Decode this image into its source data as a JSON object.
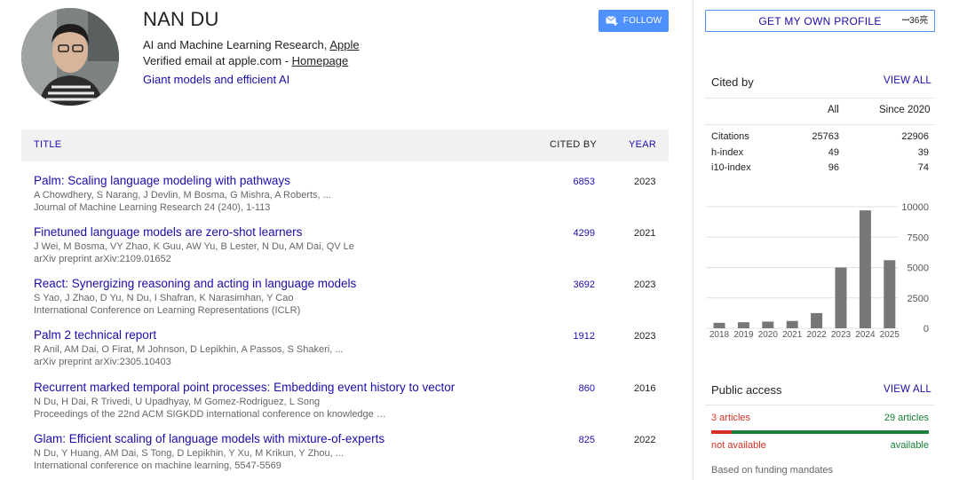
{
  "profile": {
    "name": "NAN DU",
    "affiliation_prefix": "AI and Machine Learning Research, ",
    "affiliation_link": "Apple",
    "verified_prefix": "Verified email at apple.com - ",
    "homepage_link": "Homepage",
    "interest": "Giant models and efficient AI",
    "follow_label": "FOLLOW"
  },
  "table": {
    "header": {
      "title": "TITLE",
      "cited_by": "CITED BY",
      "year": "YEAR"
    },
    "rows": [
      {
        "title": "Palm: Scaling language modeling with pathways",
        "authors": "A Chowdhery, S Narang, J Devlin, M Bosma, G Mishra, A Roberts, ...",
        "venue": "Journal of Machine Learning Research 24 (240), 1-113",
        "cited_by": "6853",
        "year": "2023"
      },
      {
        "title": "Finetuned language models are zero-shot learners",
        "authors": "J Wei, M Bosma, VY Zhao, K Guu, AW Yu, B Lester, N Du, AM Dai, QV Le",
        "venue": "arXiv preprint arXiv:2109.01652",
        "cited_by": "4299",
        "year": "2021"
      },
      {
        "title": "React: Synergizing reasoning and acting in language models",
        "authors": "S Yao, J Zhao, D Yu, N Du, I Shafran, K Narasimhan, Y Cao",
        "venue": "International Conference on Learning Representations (ICLR)",
        "cited_by": "3692",
        "year": "2023"
      },
      {
        "title": "Palm 2 technical report",
        "authors": "R Anil, AM Dai, O Firat, M Johnson, D Lepikhin, A Passos, S Shakeri, ...",
        "venue": "arXiv preprint arXiv:2305.10403",
        "cited_by": "1912",
        "year": "2023"
      },
      {
        "title": "Recurrent marked temporal point processes: Embedding event history to vector",
        "authors": "N Du, H Dai, R Trivedi, U Upadhyay, M Gomez-Rodriguez, L Song",
        "venue": "Proceedings of the 22nd ACM SIGKDD international conference on knowledge …",
        "cited_by": "860",
        "year": "2016"
      },
      {
        "title": "Glam: Efficient scaling of language models with mixture-of-experts",
        "authors": "N Du, Y Huang, AM Dai, S Tong, D Lepikhin, Y Xu, M Krikun, Y Zhou, ...",
        "venue": "International conference on machine learning, 5547-5569",
        "cited_by": "825",
        "year": "2022"
      }
    ]
  },
  "sidebar": {
    "own_profile_label": "GET MY OWN PROFILE",
    "badge": "ꟷ36亮",
    "cited_by": {
      "title": "Cited by",
      "view_all": "VIEW ALL",
      "col_all": "All",
      "col_since": "Since 2020",
      "stats": [
        {
          "label": "Citations",
          "all": "25763",
          "since": "22906"
        },
        {
          "label": "h-index",
          "all": "49",
          "since": "39"
        },
        {
          "label": "i10-index",
          "all": "96",
          "since": "74"
        }
      ]
    },
    "public_access": {
      "title": "Public access",
      "view_all": "VIEW ALL",
      "not_available_count": "3 articles",
      "available_count": "29 articles",
      "not_available_label": "not available",
      "available_label": "available",
      "not_available_fraction": 0.094,
      "note": "Based on funding mandates"
    }
  },
  "colors": {
    "link": "#1a0dab",
    "button": "#4d90fe",
    "bar": "#777777",
    "not_available": "#d93025",
    "available": "#188038"
  },
  "chart_data": {
    "type": "bar",
    "categories": [
      "2018",
      "2019",
      "2020",
      "2021",
      "2022",
      "2023",
      "2024",
      "2025"
    ],
    "values": [
      450,
      500,
      550,
      600,
      1250,
      5000,
      9700,
      5600
    ],
    "ylim": [
      0,
      10000
    ],
    "yticks": [
      "0",
      "2500",
      "5000",
      "7500",
      "10000"
    ],
    "grid": true
  }
}
